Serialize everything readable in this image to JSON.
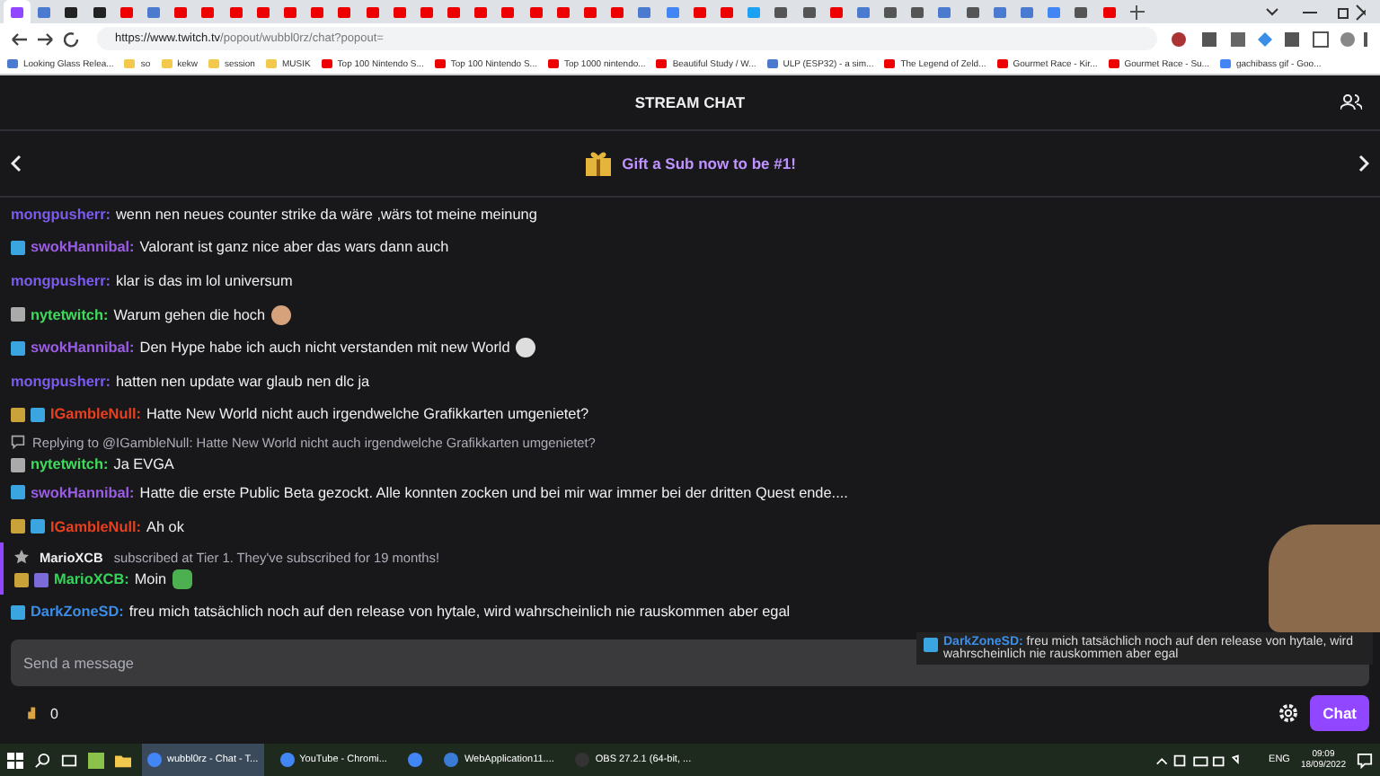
{
  "browser": {
    "tabs": [
      {
        "kind": "twitch",
        "selected": true
      },
      {
        "kind": "page",
        "selected": false
      },
      {
        "kind": "github",
        "selected": false
      },
      {
        "kind": "github",
        "selected": false
      },
      {
        "kind": "youtube",
        "selected": false
      },
      {
        "kind": "page",
        "selected": false
      },
      {
        "kind": "youtube",
        "selected": false
      },
      {
        "kind": "youtube",
        "selected": false
      },
      {
        "kind": "youtube",
        "selected": false
      },
      {
        "kind": "youtube",
        "selected": false
      },
      {
        "kind": "youtube",
        "selected": false
      },
      {
        "kind": "youtube",
        "selected": false
      },
      {
        "kind": "youtube",
        "selected": false
      },
      {
        "kind": "youtube",
        "selected": false
      },
      {
        "kind": "youtube",
        "selected": false
      },
      {
        "kind": "youtube",
        "selected": false
      },
      {
        "kind": "youtube",
        "selected": false
      },
      {
        "kind": "youtube",
        "selected": false
      },
      {
        "kind": "youtube",
        "selected": false
      },
      {
        "kind": "youtube",
        "selected": false
      },
      {
        "kind": "youtube",
        "selected": false
      },
      {
        "kind": "youtube",
        "selected": false
      },
      {
        "kind": "youtube",
        "selected": false
      },
      {
        "kind": "page",
        "selected": false
      },
      {
        "kind": "google",
        "selected": false
      },
      {
        "kind": "youtube",
        "selected": false
      },
      {
        "kind": "youtube",
        "selected": false
      },
      {
        "kind": "twitter",
        "selected": false
      },
      {
        "kind": "amazon",
        "selected": false
      },
      {
        "kind": "amazon",
        "selected": false
      },
      {
        "kind": "youtube",
        "selected": false
      },
      {
        "kind": "page",
        "selected": false
      },
      {
        "kind": "amazon",
        "selected": false
      },
      {
        "kind": "amazon",
        "selected": false
      },
      {
        "kind": "page",
        "selected": false
      },
      {
        "kind": "amazon",
        "selected": false
      },
      {
        "kind": "page",
        "selected": false
      },
      {
        "kind": "page",
        "selected": false
      },
      {
        "kind": "google",
        "selected": false
      },
      {
        "kind": "amazon",
        "selected": false
      },
      {
        "kind": "youtube",
        "selected": false
      }
    ],
    "url_host": "https://www.twitch.tv",
    "url_path": "/popout/wubbl0rz/chat?popout=",
    "bookmarks": [
      {
        "kind": "page",
        "label": "Looking Glass Relea..."
      },
      {
        "kind": "folder",
        "label": "so"
      },
      {
        "kind": "folder",
        "label": "kekw"
      },
      {
        "kind": "folder",
        "label": "session"
      },
      {
        "kind": "folder",
        "label": "MUSIK"
      },
      {
        "kind": "youtube",
        "label": "Top 100 Nintendo S..."
      },
      {
        "kind": "youtube",
        "label": "Top 100 Nintendo S..."
      },
      {
        "kind": "youtube",
        "label": "Top 1000 nintendo..."
      },
      {
        "kind": "youtube",
        "label": "Beautiful Study / W..."
      },
      {
        "kind": "page",
        "label": "ULP (ESP32) - a sim..."
      },
      {
        "kind": "youtube",
        "label": "The Legend of Zeld..."
      },
      {
        "kind": "youtube",
        "label": "Gourmet Race - Kir..."
      },
      {
        "kind": "youtube",
        "label": "Gourmet Race - Su..."
      },
      {
        "kind": "google",
        "label": "gachibass gif - Goo..."
      }
    ]
  },
  "chat": {
    "title": "STREAM CHAT",
    "banner": "Gift a Sub now to be #1!",
    "messages": [
      {
        "kind": "message",
        "user": "mongpusherr:",
        "color": "#7c5cf0",
        "text": "wenn nen neues counter strike da wäre ,wärs tot meine meinung"
      },
      {
        "kind": "message",
        "badges": [
          {
            "kind": "sub"
          }
        ],
        "user": "swokHannibal:",
        "color": "#9b5de5",
        "text": "Valorant ist ganz nice aber das wars dann auch"
      },
      {
        "kind": "message",
        "user": "mongpusherr:",
        "color": "#7c5cf0",
        "text": "klar is das im lol universum"
      },
      {
        "kind": "message",
        "badges": [
          {
            "kind": "gift"
          }
        ],
        "user": "nytetwitch:",
        "color": "#3ddc5a",
        "text": "Warum gehen die hoch",
        "emote": {
          "kind": "face"
        }
      },
      {
        "kind": "message",
        "badges": [
          {
            "kind": "sub"
          }
        ],
        "user": "swokHannibal:",
        "color": "#9b5de5",
        "text": "Den Hype habe ich auch nicht verstanden mit new World",
        "emote": {
          "kind": "ghost"
        }
      },
      {
        "kind": "message",
        "user": "mongpusherr:",
        "color": "#7c5cf0",
        "text": "hatten nen update war glaub nen dlc ja"
      },
      {
        "kind": "message",
        "badges": [
          {
            "kind": "bits"
          },
          {
            "kind": "sub"
          }
        ],
        "user": "IGambleNull:",
        "color": "#e8401e",
        "text": "Hatte New World nicht auch irgendwelche Grafikkarten umgenietet?"
      },
      {
        "kind": "reply",
        "badges": [
          {
            "kind": "gift"
          }
        ],
        "user": "nytetwitch:",
        "color": "#3ddc5a",
        "reply_to": "Replying to @IGambleNull: Hatte New World nicht auch irgendwelche Grafikkarten umgenietet?",
        "text": "Ja EVGA"
      },
      {
        "kind": "message",
        "badges": [
          {
            "kind": "sub"
          }
        ],
        "user": "swokHannibal:",
        "color": "#9b5de5",
        "text": "Hatte die erste Public Beta gezockt. Alle konnten zocken und bei mir war immer bei der dritten Quest ende...."
      },
      {
        "kind": "message",
        "badges": [
          {
            "kind": "bits"
          },
          {
            "kind": "sub"
          }
        ],
        "user": "IGambleNull:",
        "color": "#e8401e",
        "text": "Ah ok"
      },
      {
        "kind": "sub",
        "notice_user": "MarioXCB",
        "notice": "subscribed at Tier 1. They've subscribed for 19 months!",
        "badges": [
          {
            "kind": "bits"
          },
          {
            "kind": "custom"
          }
        ],
        "user": "MarioXCB:",
        "color": "#36d35a",
        "text": "Moin",
        "emote": {
          "kind": "frog"
        }
      },
      {
        "kind": "message",
        "badges": [
          {
            "kind": "sub"
          }
        ],
        "user": "DarkZoneSD:",
        "color": "#3b8ee8",
        "text": "freu mich tatsächlich noch auf den release von hytale, wird wahrscheinlich nie rauskommen aber egal"
      }
    ],
    "input_placeholder": "Send a message",
    "points": "0",
    "send": "Chat"
  },
  "overlay": {
    "user": "DarkZoneSD:",
    "color": "#3b8ee8",
    "text": "freu mich tatsächlich noch auf den release von hytale, wird wahrscheinlich nie rauskommen aber egal"
  },
  "taskbar": {
    "items": [
      {
        "kind": "chrome",
        "label": "wubbl0rz - Chat - T...",
        "selected": true
      },
      {
        "kind": "chrome",
        "label": "YouTube - Chromi...",
        "selected": false
      },
      {
        "kind": "chrome",
        "selected": false
      },
      {
        "kind": "app",
        "label": "WebApplication11....",
        "selected": false
      },
      {
        "kind": "obs",
        "label": "OBS 27.2.1 (64-bit, ...",
        "selected": false
      }
    ],
    "lang": "ENG",
    "time": "09:09",
    "date": "18/09/2022"
  }
}
